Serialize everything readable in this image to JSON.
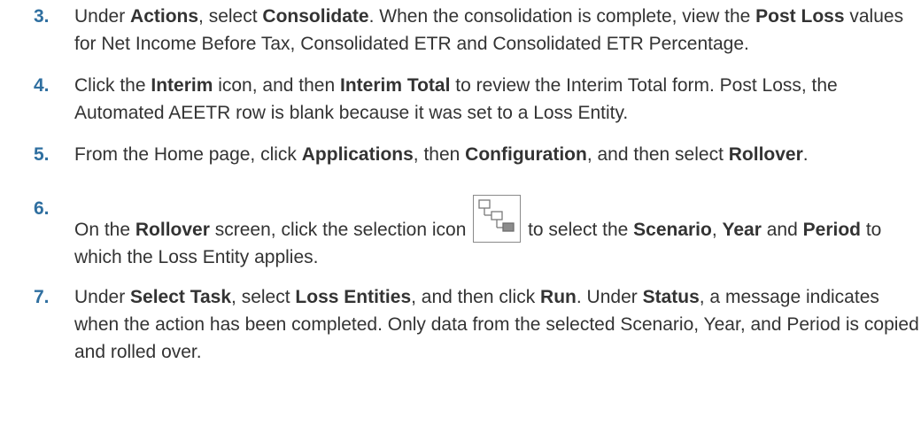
{
  "steps": [
    {
      "number": "3.",
      "parts": [
        "Under ",
        "Actions",
        ", select ",
        "Consolidate",
        ". When the consolidation is complete, view the ",
        "Post Loss",
        " values for Net Income Before Tax, Consolidated ETR and Consolidated ETR Percentage."
      ]
    },
    {
      "number": "4.",
      "parts": [
        "Click the ",
        "Interim",
        " icon, and then ",
        "Interim Total",
        " to review the Interim Total form. Post Loss, the Automated AEETR row is blank because it was set to a Loss Entity."
      ]
    },
    {
      "number": "5.",
      "parts": [
        "From the Home page, click ",
        "Applications",
        ", then ",
        "Configuration",
        ", and then select ",
        "Rollover",
        "."
      ]
    },
    {
      "number": "6.",
      "parts": [
        "On the ",
        "Rollover",
        " screen, click the selection icon ",
        " to select the ",
        "Scenario",
        ", ",
        "Year",
        " and ",
        "Period",
        " to which the Loss Entity applies."
      ],
      "icon": "selection-hierarchy-icon"
    },
    {
      "number": "7.",
      "parts": [
        "Under ",
        "Select Task",
        ", select ",
        "Loss Entities",
        ", and then click ",
        "Run",
        ". Under ",
        "Status",
        ", a message indicates when the action has been completed. Only data from the selected Scenario, Year, and Period is copied and rolled over."
      ]
    }
  ],
  "colors": {
    "step_number": "#2f6fa0",
    "text": "#333333"
  }
}
